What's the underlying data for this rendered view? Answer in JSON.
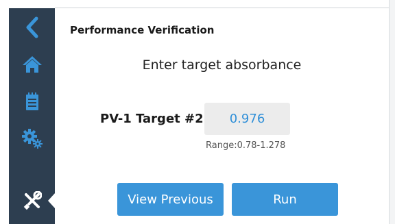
{
  "sidebar": {
    "items": [
      {
        "icon": "back-chevron-icon",
        "active": false
      },
      {
        "icon": "home-icon",
        "active": false
      },
      {
        "icon": "notepad-icon",
        "active": false
      },
      {
        "icon": "gears-icon",
        "active": false
      },
      {
        "icon": "tools-icon",
        "active": true
      }
    ],
    "background": "#2d3e50",
    "icon_color": "#3a95d9",
    "active_icon_color": "#ffffff"
  },
  "page": {
    "title": "Performance Verification",
    "instruction": "Enter target absorbance"
  },
  "target_field": {
    "label": "PV-1 Target #2:",
    "value": "0.976",
    "value_color": "#2f8fd8",
    "range_text": "Range:0.78-1.278"
  },
  "buttons": {
    "view_previous": "View Previous",
    "run": "Run",
    "color": "#3a95d9"
  }
}
